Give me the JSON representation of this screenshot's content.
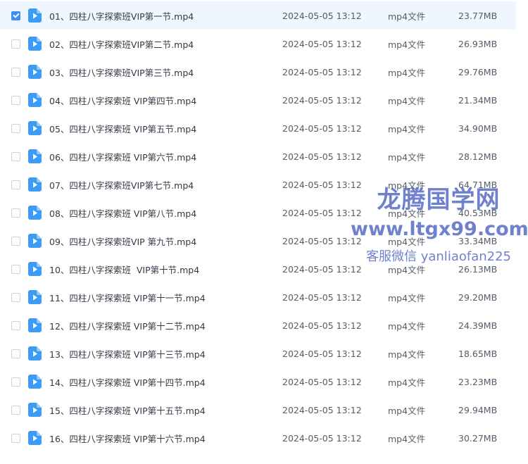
{
  "files": [
    {
      "name": "01、四柱八字探索班VIP第一节.mp4",
      "date": "2024-05-05 13:12",
      "type": "mp4文件",
      "size": "23.77MB",
      "selected": true
    },
    {
      "name": "02、四柱八字探索班VIP第二节.mp4",
      "date": "2024-05-05 13:12",
      "type": "mp4文件",
      "size": "26.93MB",
      "selected": false
    },
    {
      "name": "03、四柱八字探索班VIP第三节.mp4",
      "date": "2024-05-05 13:12",
      "type": "mp4文件",
      "size": "29.76MB",
      "selected": false
    },
    {
      "name": "04、四柱八字探索班 VIP第四节.mp4",
      "date": "2024-05-05 13:12",
      "type": "mp4文件",
      "size": "21.34MB",
      "selected": false
    },
    {
      "name": "05、四柱八字探索班 VIP第五节.mp4",
      "date": "2024-05-05 13:12",
      "type": "mp4文件",
      "size": "34.90MB",
      "selected": false
    },
    {
      "name": "06、四柱八字探索班 VIP第六节.mp4",
      "date": "2024-05-05 13:12",
      "type": "mp4文件",
      "size": "28.12MB",
      "selected": false
    },
    {
      "name": "07、四柱八字探索班VIP第七节.mp4",
      "date": "2024-05-05 13:12",
      "type": "mp4文件",
      "size": "64.71MB",
      "selected": false
    },
    {
      "name": "08、四柱八字探索班 VIP第八节.mp4",
      "date": "2024-05-05 13:12",
      "type": "mp4文件",
      "size": "40.53MB",
      "selected": false
    },
    {
      "name": "09、四柱八字探索班VIP 第九节.mp4",
      "date": "2024-05-05 13:12",
      "type": "mp4文件",
      "size": "33.34MB",
      "selected": false
    },
    {
      "name": "10、四柱八字探索班  VIP第十节.mp4",
      "date": "2024-05-05 13:12",
      "type": "mp4文件",
      "size": "26.13MB",
      "selected": false
    },
    {
      "name": "11、四柱八字探索班 VIP第十一节.mp4",
      "date": "2024-05-05 13:12",
      "type": "mp4文件",
      "size": "29.20MB",
      "selected": false
    },
    {
      "name": "12、四柱八字探索班 VIP第十二节.mp4",
      "date": "2024-05-05 13:12",
      "type": "mp4文件",
      "size": "24.39MB",
      "selected": false
    },
    {
      "name": "13、四柱八字探索班 VIP第十三节.mp4",
      "date": "2024-05-05 13:12",
      "type": "mp4文件",
      "size": "18.65MB",
      "selected": false
    },
    {
      "name": "14、四柱八字探索班 VIP第十四节.mp4",
      "date": "2024-05-05 13:12",
      "type": "mp4文件",
      "size": "23.23MB",
      "selected": false
    },
    {
      "name": "15、四柱八字探索班 VIP第十五节.mp4",
      "date": "2024-05-05 13:12",
      "type": "mp4文件",
      "size": "29.94MB",
      "selected": false
    },
    {
      "name": "16、四柱八字探索班 VIP第十六节.mp4",
      "date": "2024-05-05 13:12",
      "type": "mp4文件",
      "size": "30.27MB",
      "selected": false
    }
  ],
  "icons": {
    "file": "video-file-icon",
    "checkbox": "checkbox"
  },
  "watermark": {
    "title": "龙腾国学网",
    "url": "www.ltgx99.com",
    "contact": "客服微信 yanliaofan225"
  },
  "colors": {
    "accent": "#3b8df5",
    "selected_row": "#f0f6ff",
    "watermark": "#3750b9"
  }
}
